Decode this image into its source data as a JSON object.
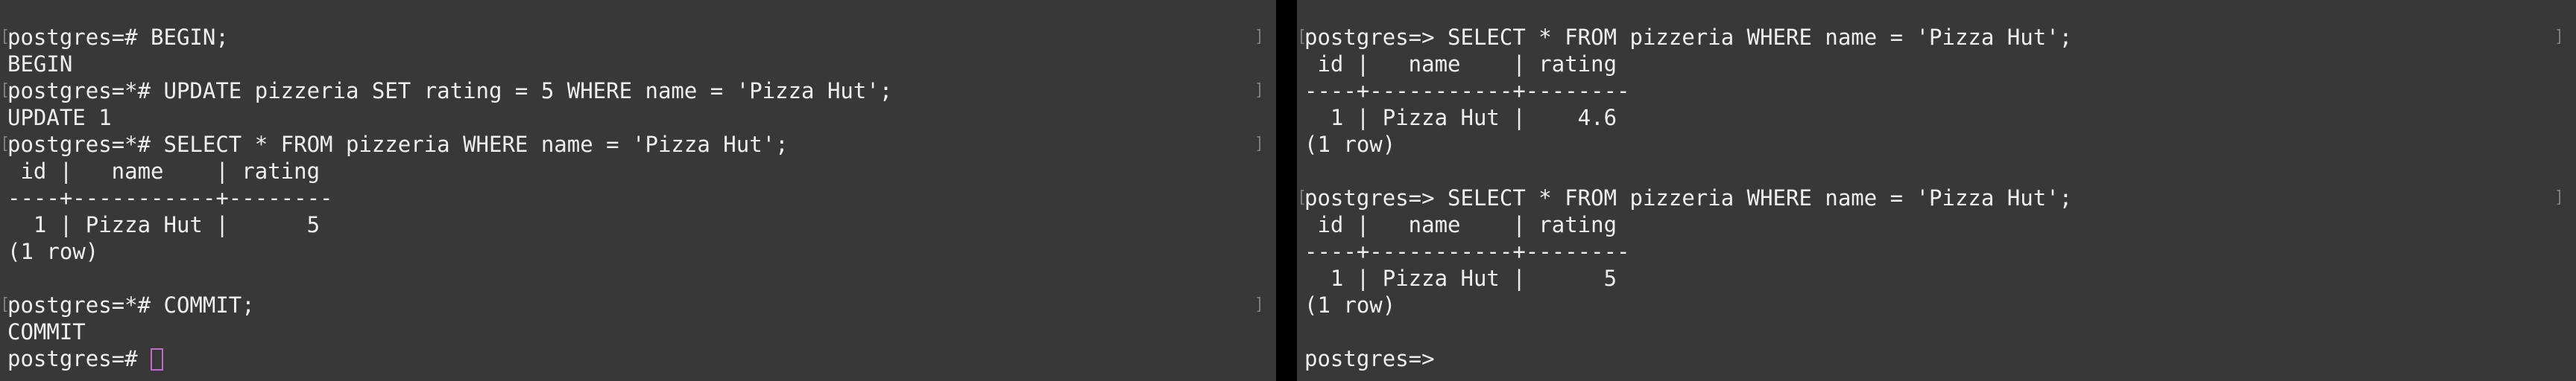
{
  "left_pane": {
    "lines": [
      {
        "text": "postgres=# BEGIN;",
        "bracketed": true
      },
      {
        "text": "BEGIN",
        "bracketed": false
      },
      {
        "text": "postgres=*# UPDATE pizzeria SET rating = 5 WHERE name = 'Pizza Hut';",
        "bracketed": true
      },
      {
        "text": "UPDATE 1",
        "bracketed": false
      },
      {
        "text": "postgres=*# SELECT * FROM pizzeria WHERE name = 'Pizza Hut';",
        "bracketed": true
      },
      {
        "text": " id |   name    | rating",
        "bracketed": false
      },
      {
        "text": "----+-----------+--------",
        "bracketed": false
      },
      {
        "text": "  1 | Pizza Hut |      5",
        "bracketed": false
      },
      {
        "text": "(1 row)",
        "bracketed": false
      },
      {
        "text": "",
        "bracketed": false
      },
      {
        "text": "postgres=*# COMMIT;",
        "bracketed": true
      },
      {
        "text": "COMMIT",
        "bracketed": false
      }
    ],
    "prompt": "postgres=# "
  },
  "right_pane": {
    "lines": [
      {
        "text": "postgres=> SELECT * FROM pizzeria WHERE name = 'Pizza Hut';",
        "bracketed": true
      },
      {
        "text": " id |   name    | rating",
        "bracketed": false
      },
      {
        "text": "----+-----------+--------",
        "bracketed": false
      },
      {
        "text": "  1 | Pizza Hut |    4.6",
        "bracketed": false
      },
      {
        "text": "(1 row)",
        "bracketed": false
      },
      {
        "text": "",
        "bracketed": false
      },
      {
        "text": "postgres=> SELECT * FROM pizzeria WHERE name = 'Pizza Hut';",
        "bracketed": true
      },
      {
        "text": " id |   name    | rating",
        "bracketed": false
      },
      {
        "text": "----+-----------+--------",
        "bracketed": false
      },
      {
        "text": "  1 | Pizza Hut |      5",
        "bracketed": false
      },
      {
        "text": "(1 row)",
        "bracketed": false
      },
      {
        "text": "",
        "bracketed": false
      }
    ],
    "prompt": "postgres=> "
  },
  "bracket_open": "[",
  "bracket_close": "]",
  "colors": {
    "background": "#383838",
    "text": "#eeeeee",
    "bracket": "#7e7e7e",
    "cursor": "#c06cc8",
    "divider": "#000000"
  }
}
